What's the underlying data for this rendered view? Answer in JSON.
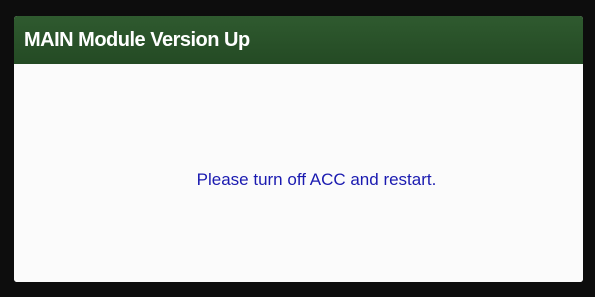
{
  "dialog": {
    "title": "MAIN Module Version Up",
    "message": "Please turn off ACC and restart."
  },
  "colors": {
    "title_bar": "#2b552b",
    "title_text": "#ffffff",
    "message_text": "#1a1ab0",
    "background": "#ffffff",
    "bezel": "#0d0d0d"
  }
}
